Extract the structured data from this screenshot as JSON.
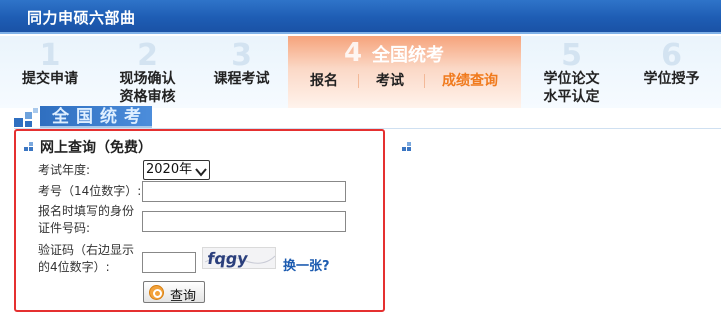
{
  "app": {
    "title": "同力申硕六部曲"
  },
  "steps": [
    {
      "num": "1",
      "label": "提交申请"
    },
    {
      "num": "2",
      "label_line1": "现场确认",
      "label_line2": "资格审核"
    },
    {
      "num": "3",
      "label": "课程考试"
    },
    {
      "num": "4",
      "title": "全国统考",
      "subs": [
        "报名",
        "考试",
        "成绩查询"
      ]
    },
    {
      "num": "5",
      "label_line1": "学位论文",
      "label_line2": "水平认定"
    },
    {
      "num": "6",
      "label": "学位授予"
    }
  ],
  "section": {
    "title": "全国统考"
  },
  "form": {
    "title": "网上查询（免费）",
    "year_label": "考试年度:",
    "year_value": "2020年",
    "exam_no_label": "考号（14位数字）:",
    "id_label_line1": "报名时填写的身份",
    "id_label_line2": "证件号码:",
    "captcha_label_line1": "验证码（右边显示",
    "captcha_label_line2": "的4位数字）:",
    "captcha_text": "fqgy",
    "change_link": "换一张?",
    "query_button": "查询"
  },
  "colors": {
    "title_bar": "#1e5db4",
    "active_step": "#f6a37b",
    "active_sub": "#f07a1d",
    "panel_border": "#e53030",
    "link": "#1c5bb0"
  }
}
